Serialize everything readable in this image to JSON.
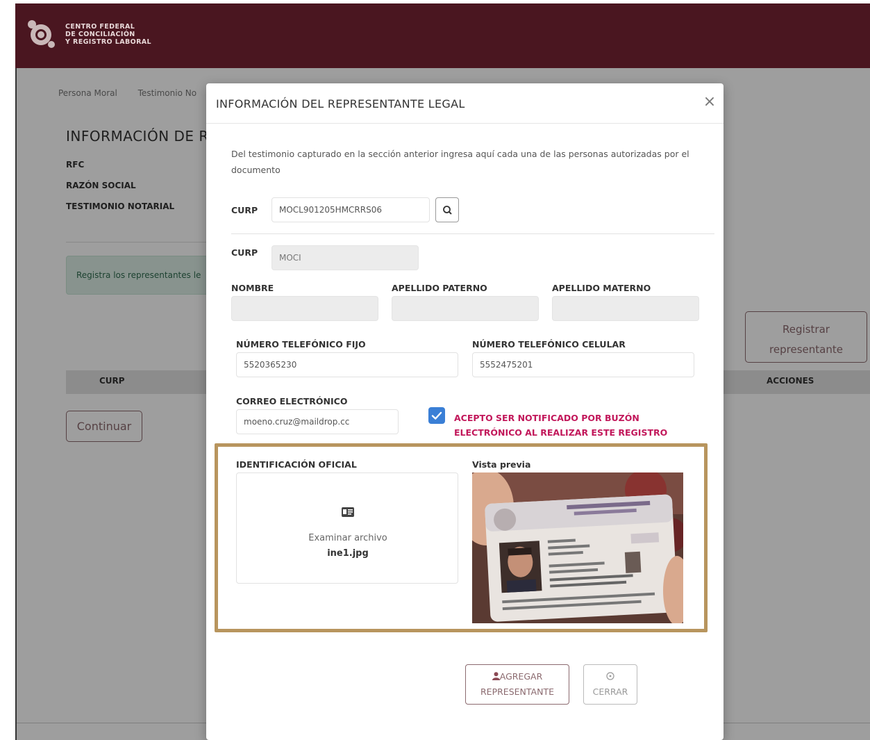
{
  "header": {
    "logo_lines": [
      "CENTRO FEDERAL",
      "DE CONCILIACIÓN",
      "Y REGISTRO LABORAL"
    ]
  },
  "background": {
    "breadcrumbs": [
      "Persona Moral",
      "Testimonio No"
    ],
    "title": "INFORMACIÓN DE R",
    "fields": [
      "RFC",
      "RAZÓN SOCIAL",
      "TESTIMONIO NOTARIAL"
    ],
    "alert_text": "Registra los representantes le",
    "register_button": "Registrar representante",
    "table_headers": {
      "curp": "CURP",
      "actions": "ACCIONES"
    },
    "continue_button": "Continuar"
  },
  "modal": {
    "title": "INFORMACIÓN DEL REPRESENTANTE LEGAL",
    "close_glyph": "×",
    "intro": "Del testimonio capturado en la sección anterior ingresa aquí cada una de las personas autorizadas por el documento",
    "curp_search": {
      "label": "CURP",
      "value": "MOCL901205HMCRRS06"
    },
    "curp": {
      "label": "CURP",
      "value": "MOCI"
    },
    "nombre": {
      "label": "NOMBRE",
      "value": ""
    },
    "apellido_paterno": {
      "label": "APELLIDO PATERNO",
      "value": ""
    },
    "apellido_materno": {
      "label": "APELLIDO MATERNO",
      "value": ""
    },
    "telefono_fijo": {
      "label": "NÚMERO TELEFÓNICO FIJO",
      "value": "5520365230"
    },
    "telefono_celular": {
      "label": "NÚMERO TELEFÓNICO CELULAR",
      "value": "5552475201"
    },
    "correo": {
      "label": "CORREO ELECTRÓNICO",
      "value": "moeno.cruz@maildrop.cc"
    },
    "consent": {
      "checked": true,
      "line1": "ACEPTO SER NOTIFICADO POR BUZÓN",
      "line2": "ELECTRÓNICO AL REALIZAR ESTE REGISTRO"
    },
    "identificacion": {
      "label": "IDENTIFICACIÓN OFICIAL",
      "browse_text": "Examinar archivo",
      "file_name": "ine1.jpg"
    },
    "preview": {
      "label": "Vista previa"
    },
    "add_button": {
      "line1": "AGREGAR",
      "line2": "REPRESENTANTE"
    },
    "cancel_button": "CERRAR"
  },
  "colors": {
    "brand": "#4a1620",
    "accent_border": "#b8955e",
    "checkbox": "#3a7fd6",
    "consent_text": "#c2185b",
    "button_text": "#8b6a6f"
  },
  "icons": [
    "search-icon",
    "close-icon",
    "file-card-icon",
    "user-icon",
    "circle-x-icon"
  ]
}
